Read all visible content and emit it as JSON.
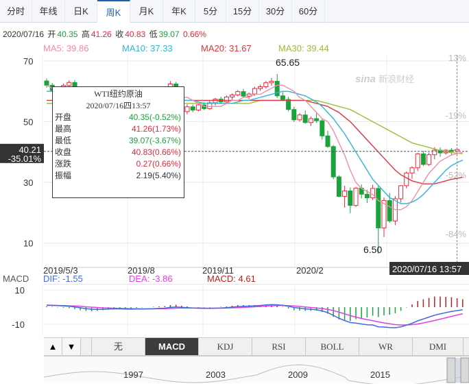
{
  "tabs": [
    "分时",
    "年线",
    "日K",
    "周K",
    "月K",
    "年K",
    "5分",
    "15分",
    "30分",
    "60分"
  ],
  "active_tab": "周K",
  "header": {
    "date": "2020/07/16",
    "open_label": "开",
    "open": "40.35",
    "high_label": "高",
    "high": "41.26",
    "close_label": "收",
    "close": "40.83",
    "low_label": "低",
    "low": "39.07",
    "change": "0.66%"
  },
  "ma": {
    "ma5": "MA5: 39.86",
    "ma10": "MA10: 37.33",
    "ma20": "MA20: 31.67",
    "ma30": "MA30: 39.44"
  },
  "colors": {
    "up": "#e8263c",
    "down": "#1aa33d",
    "ma5": "#f08da7",
    "ma10": "#2fb5d8",
    "ma20": "#d9363e",
    "ma30": "#9cbb3b",
    "dif": "#4169e1",
    "dea": "#e040e0",
    "macd": "#b22222"
  },
  "watermark": "新浪财经",
  "watermark_mark": "sina",
  "tooltip": {
    "title": "WTI纽约原油",
    "datetime": "2020/07/16四13:57",
    "rows": [
      {
        "label": "开盘",
        "value": "40.35(-0.52%)",
        "dir": "down"
      },
      {
        "label": "最高",
        "value": "41.26(1.73%)",
        "dir": "up"
      },
      {
        "label": "最低",
        "value": "39.07(-3.67%)",
        "dir": "down"
      },
      {
        "label": "收盘",
        "value": "40.83(0.66%)",
        "dir": "up"
      },
      {
        "label": "涨跌",
        "value": "0.27(0.66%)",
        "dir": "up"
      },
      {
        "label": "振幅",
        "value": "2.19(5.40%)",
        "dir": "none"
      }
    ]
  },
  "crosshair": {
    "price": "40.21",
    "pct": "-35.01%",
    "time": "2020/07/16 13:57"
  },
  "annotations": {
    "max": "65.65",
    "min": "6.50"
  },
  "macd_info": {
    "label": "MACD",
    "dif": "DIF: -1.55",
    "dea": "DEA: -3.86",
    "macd": "MACD: 4.61"
  },
  "indicator_buttons": [
    "无",
    "MACD",
    "KDJ",
    "RSI",
    "BOLL",
    "WR",
    "DMI"
  ],
  "active_indicator": "MACD",
  "nav_buttons": [
    "▲",
    "▼"
  ],
  "timeline_labels": [
    "1997",
    "2003",
    "2009",
    "2015"
  ],
  "chart_data": {
    "type": "candlestick",
    "y_ticks": [
      70,
      50,
      30,
      10
    ],
    "y_range": [
      2,
      72
    ],
    "right_ticks": [
      "13%",
      "-19%",
      "-52%",
      "-84%"
    ],
    "x_labels": [
      "2019/5/3",
      "2019/8",
      "2019/11",
      "2020/2"
    ],
    "macd_ticks": [
      10,
      -10
    ],
    "candles": [
      [
        63.4,
        64.2,
        61.2,
        62.0
      ],
      [
        62.0,
        62.7,
        59.8,
        60.3
      ],
      [
        60.3,
        61.2,
        58.8,
        59.6
      ],
      [
        59.6,
        62.5,
        59.1,
        61.9
      ],
      [
        61.9,
        63.6,
        60.8,
        62.9
      ],
      [
        62.9,
        63.7,
        57.9,
        58.6
      ],
      [
        58.6,
        59.4,
        55.1,
        55.6
      ],
      [
        55.6,
        57.1,
        53.8,
        54.3
      ],
      [
        54.3,
        56.9,
        53.6,
        56.1
      ],
      [
        56.1,
        58.4,
        55.3,
        57.5
      ],
      [
        57.5,
        58.8,
        56.3,
        57.0
      ],
      [
        57.0,
        60.1,
        56.5,
        59.6
      ],
      [
        59.6,
        60.9,
        58.4,
        58.8
      ],
      [
        58.8,
        59.8,
        56.9,
        57.2
      ],
      [
        57.2,
        58.3,
        55.5,
        56.1
      ],
      [
        56.1,
        57.2,
        53.8,
        54.5
      ],
      [
        54.5,
        56.8,
        53.9,
        56.1
      ],
      [
        56.1,
        57.0,
        54.7,
        55.1
      ],
      [
        55.1,
        56.6,
        54.3,
        55.9
      ],
      [
        55.9,
        57.4,
        55.2,
        56.7
      ],
      [
        56.7,
        58.0,
        55.9,
        57.2
      ],
      [
        57.2,
        58.4,
        55.6,
        56.0
      ],
      [
        56.0,
        63.4,
        55.5,
        62.4
      ],
      [
        62.4,
        63.1,
        56.9,
        57.6
      ],
      [
        57.6,
        58.1,
        52.9,
        53.3
      ],
      [
        53.3,
        55.7,
        52.4,
        54.9
      ],
      [
        54.9,
        55.6,
        53.1,
        53.8
      ],
      [
        53.8,
        56.0,
        53.4,
        55.5
      ],
      [
        55.5,
        56.4,
        53.8,
        54.3
      ],
      [
        54.3,
        56.9,
        53.8,
        56.2
      ],
      [
        56.2,
        57.8,
        55.3,
        57.4
      ],
      [
        57.4,
        58.2,
        55.8,
        56.5
      ],
      [
        56.5,
        58.6,
        56.1,
        58.1
      ],
      [
        58.1,
        59.3,
        57.2,
        58.8
      ],
      [
        58.8,
        60.4,
        58.3,
        59.9
      ],
      [
        59.9,
        60.8,
        57.9,
        58.4
      ],
      [
        58.4,
        59.6,
        57.4,
        59.1
      ],
      [
        59.1,
        61.5,
        58.5,
        60.9
      ],
      [
        60.9,
        62.2,
        60.1,
        61.5
      ],
      [
        61.5,
        63.4,
        60.9,
        62.8
      ],
      [
        62.8,
        64.4,
        61.8,
        63.3
      ],
      [
        63.3,
        65.65,
        57.8,
        58.5
      ],
      [
        58.5,
        59.7,
        56.8,
        57.3
      ],
      [
        57.3,
        58.2,
        53.4,
        54.0
      ],
      [
        54.0,
        54.9,
        49.9,
        50.6
      ],
      [
        50.6,
        52.8,
        50.0,
        52.2
      ],
      [
        52.2,
        53.7,
        49.3,
        49.7
      ],
      [
        49.7,
        51.7,
        48.6,
        51.0
      ],
      [
        51.0,
        52.9,
        49.6,
        50.3
      ],
      [
        50.3,
        51.1,
        44.1,
        45.3
      ],
      [
        45.3,
        47.0,
        41.4,
        41.8
      ],
      [
        41.8,
        42.3,
        31.1,
        31.8
      ],
      [
        31.8,
        32.4,
        25.1,
        25.4
      ],
      [
        25.4,
        28.9,
        21.7,
        27.2
      ],
      [
        27.2,
        28.3,
        19.9,
        22.4
      ],
      [
        22.4,
        28.5,
        21.9,
        28.1
      ],
      [
        28.1,
        29.3,
        24.7,
        26.1
      ],
      [
        26.1,
        27.6,
        23.2,
        24.9
      ],
      [
        24.9,
        29.2,
        24.2,
        28.0
      ],
      [
        28.0,
        29.0,
        6.5,
        15.0
      ],
      [
        15.0,
        25.0,
        12.0,
        24.0
      ],
      [
        24.0,
        26.5,
        16.7,
        17.3
      ],
      [
        17.3,
        25.5,
        15.9,
        24.6
      ],
      [
        24.6,
        29.1,
        23.4,
        28.9
      ],
      [
        28.9,
        33.6,
        28.0,
        33.1
      ],
      [
        33.1,
        35.3,
        31.2,
        34.8
      ],
      [
        34.8,
        39.7,
        33.7,
        39.4
      ],
      [
        39.4,
        40.3,
        35.4,
        35.9
      ],
      [
        35.9,
        39.8,
        35.4,
        39.1
      ],
      [
        39.1,
        41.6,
        37.6,
        40.6
      ],
      [
        40.6,
        41.5,
        38.4,
        39.7
      ],
      [
        39.7,
        40.9,
        39.1,
        40.6
      ],
      [
        40.6,
        41.3,
        38.9,
        40.2
      ],
      [
        40.35,
        41.26,
        39.07,
        40.83
      ]
    ],
    "ma_series": {
      "ma5": [
        62,
        61,
        61,
        61,
        61,
        61,
        60,
        59,
        58,
        57,
        56,
        56,
        57,
        57,
        57,
        57,
        56,
        56,
        56,
        56,
        56,
        56,
        57,
        58,
        58,
        58,
        57,
        56,
        55,
        55,
        55,
        55,
        56,
        57,
        57,
        58,
        58,
        59,
        59,
        60,
        61,
        62,
        62,
        61,
        60,
        58,
        57,
        55,
        53,
        51,
        50,
        47,
        43,
        39,
        34,
        30,
        28,
        27,
        26,
        24,
        23,
        22,
        21,
        21,
        22,
        24,
        27,
        30,
        33,
        35,
        37,
        38,
        39,
        39.5,
        39.86
      ],
      "ma10": [
        60,
        60,
        60,
        60,
        60,
        60,
        60,
        59.5,
        59,
        59,
        58.5,
        58,
        58,
        57.5,
        57,
        57,
        57,
        56.5,
        56,
        56,
        56,
        56,
        56,
        56.5,
        57,
        57,
        57,
        56.5,
        56,
        56,
        56,
        56,
        56,
        56,
        56.5,
        57,
        57,
        57.5,
        58,
        58.5,
        59,
        59.5,
        60,
        60,
        59.5,
        59,
        58.5,
        57.5,
        56.5,
        55,
        53,
        51,
        48.5,
        46,
        43,
        40,
        37,
        34,
        31,
        29,
        27,
        25,
        24,
        23,
        23,
        23.5,
        24.5,
        26,
        28,
        30,
        32,
        34,
        35.5,
        36.5,
        37.33
      ],
      "ma20": [
        57,
        57,
        57,
        57,
        57,
        57,
        57,
        57,
        57,
        57,
        57,
        57,
        57,
        57,
        57,
        57,
        57,
        57,
        57,
        57,
        57,
        57,
        57,
        57,
        57,
        57,
        57,
        57,
        57,
        57,
        57,
        57,
        57,
        57,
        57,
        57,
        57,
        57,
        57,
        57,
        57,
        57,
        57,
        57,
        57,
        57,
        57,
        56.5,
        56,
        55.5,
        55,
        54,
        53,
        51.5,
        50,
        48,
        46,
        44,
        42,
        40,
        38,
        36,
        34,
        32.5,
        31.5,
        30.5,
        30,
        29.5,
        29.5,
        29.5,
        30,
        30.5,
        31,
        31.3,
        31.67
      ],
      "ma30": [
        56,
        56,
        56,
        56,
        56,
        56,
        56,
        56,
        56,
        56,
        56,
        56,
        56,
        56,
        56,
        56,
        56,
        56,
        56,
        56,
        56,
        56,
        56,
        56,
        56,
        56,
        56,
        56,
        56,
        56,
        56,
        56,
        56,
        56,
        56,
        56,
        56,
        56.5,
        57,
        57,
        57,
        57,
        57,
        57,
        57,
        57,
        57,
        57,
        57,
        56.5,
        56,
        55.5,
        55,
        54.5,
        54,
        53,
        52,
        51,
        50,
        49,
        48,
        47,
        46,
        45,
        44,
        43,
        42.5,
        42,
        41.5,
        41,
        40.5,
        40,
        39.8,
        39.6,
        39.44
      ]
    },
    "macd": {
      "dif": [
        1.2,
        1.1,
        0.9,
        0.7,
        0.5,
        0.1,
        -0.4,
        -0.9,
        -1.2,
        -1.3,
        -1.3,
        -1.1,
        -1.0,
        -1.0,
        -1.1,
        -1.2,
        -1.1,
        -1.1,
        -1.0,
        -0.9,
        -0.7,
        -0.6,
        -0.1,
        0.1,
        -0.1,
        -0.3,
        -0.5,
        -0.6,
        -0.7,
        -0.7,
        -0.6,
        -0.5,
        -0.3,
        0.0,
        0.3,
        0.5,
        0.6,
        0.8,
        1.0,
        1.3,
        1.5,
        1.4,
        1.1,
        0.5,
        -0.2,
        -0.6,
        -1.0,
        -1.3,
        -1.5,
        -2.2,
        -3.2,
        -4.8,
        -6.5,
        -7.8,
        -9.0,
        -9.3,
        -9.8,
        -10.3,
        -10.4,
        -11.5,
        -11.6,
        -11.9,
        -12.0,
        -11.5,
        -10.5,
        -9.4,
        -8.0,
        -6.9,
        -5.8,
        -4.7,
        -3.9,
        -3.2,
        -2.5,
        -2.0,
        -1.55
      ],
      "dea": [
        1.0,
        1.0,
        1.0,
        0.9,
        0.8,
        0.7,
        0.5,
        0.2,
        0.0,
        -0.2,
        -0.4,
        -0.5,
        -0.6,
        -0.7,
        -0.8,
        -0.9,
        -0.9,
        -1.0,
        -1.0,
        -1.0,
        -0.9,
        -0.9,
        -0.7,
        -0.6,
        -0.5,
        -0.5,
        -0.5,
        -0.5,
        -0.6,
        -0.6,
        -0.6,
        -0.6,
        -0.5,
        -0.4,
        -0.3,
        -0.1,
        0.0,
        0.2,
        0.4,
        0.6,
        0.8,
        0.9,
        1.0,
        0.9,
        0.7,
        0.4,
        0.1,
        -0.2,
        -0.5,
        -0.8,
        -1.3,
        -2.0,
        -2.9,
        -3.9,
        -4.9,
        -5.8,
        -6.6,
        -7.3,
        -7.9,
        -8.6,
        -9.2,
        -9.7,
        -10.2,
        -10.4,
        -10.4,
        -10.2,
        -9.8,
        -9.2,
        -8.5,
        -7.8,
        -7.0,
        -6.2,
        -5.4,
        -4.6,
        -3.86
      ]
    }
  }
}
